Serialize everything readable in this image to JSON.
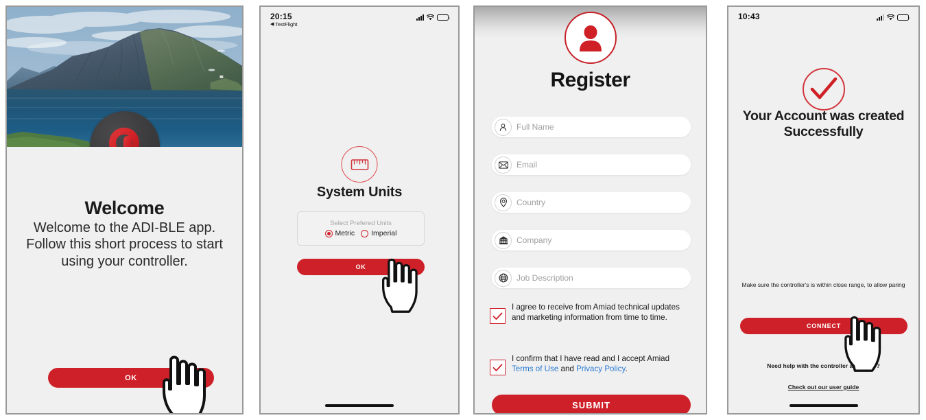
{
  "theme": {
    "brand_red": "#ce2029",
    "accent_red_light": "#de4a4f",
    "link_blue": "#2b7bd4",
    "screen_bg": "#f0f0f0",
    "text_dark": "#1b1b1b",
    "placeholder_gray": "#a0a0a0"
  },
  "panels": {
    "welcome": {
      "logo_icon": "adi-ble-logo-icon",
      "hero_image": "mountain-lake-photo",
      "title": "Welcome",
      "body": "Welcome to the ADI-BLE app. Follow this short process to start using your controller.",
      "ok_label": "OK",
      "cursor_icon": "pointing-hand-cursor-icon"
    },
    "units": {
      "status": {
        "time": "20:15",
        "back_app": "TestFlight",
        "back_arrow": "back-triangle-icon",
        "signal_icon": "cellular-signal-icon",
        "wifi_icon": "wifi-icon",
        "battery_icon": "battery-icon"
      },
      "icon": "ruler-icon",
      "title": "System Units",
      "group_label": "Select Prefered Units",
      "options": [
        {
          "label": "Metric",
          "selected": true
        },
        {
          "label": "Imperial",
          "selected": false
        }
      ],
      "ok_label": "OK",
      "cursor_icon": "pointing-hand-cursor-icon",
      "home_indicator": "home-indicator"
    },
    "register": {
      "icon": "user-avatar-icon",
      "title": "Register",
      "fields": [
        {
          "icon": "person-icon",
          "placeholder": "Full Name",
          "value": ""
        },
        {
          "icon": "envelope-icon",
          "placeholder": "Email",
          "value": ""
        },
        {
          "icon": "location-pin-icon",
          "placeholder": "Country",
          "value": ""
        },
        {
          "icon": "building-icon",
          "placeholder": "Company",
          "value": ""
        },
        {
          "icon": "globe-icon",
          "placeholder": "Job Description",
          "value": ""
        }
      ],
      "checkboxes": [
        {
          "checked": true,
          "text": "I agree to receive from Amiad technical updates and marketing information from time to time."
        },
        {
          "checked": true,
          "text_before": "I confirm that I have read and I accept Amiad ",
          "link1": "Terms of Use",
          "text_mid": " and ",
          "link2": "Privacy Policy",
          "text_after": "."
        }
      ],
      "submit_label": "SUBMIT"
    },
    "success": {
      "status": {
        "time": "10:43",
        "signal_icon": "cellular-signal-icon",
        "wifi_icon": "wifi-icon",
        "battery_icon": "battery-icon"
      },
      "icon": "check-circle-icon",
      "title": "Your Account was created Successfully",
      "hint": "Make sure the controller's is within close range, to allow paring",
      "connect_label": "CONNECT",
      "help_text": "Need help with the controller assembly?",
      "guide_link": "Check out our user guide",
      "cursor_icon": "pointing-hand-cursor-icon",
      "home_indicator": "home-indicator"
    }
  }
}
